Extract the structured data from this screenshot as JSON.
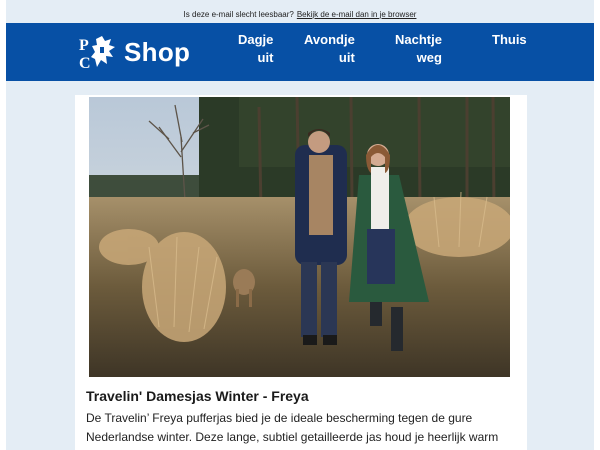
{
  "topbar": {
    "text": "Is deze e-mail slecht leesbaar?",
    "link": "Bekijk de e-mail dan in je browser"
  },
  "header": {
    "brand": "Shop",
    "brand_color": "#0750a5",
    "nav": [
      {
        "line1": "Dagje",
        "line2": "uit"
      },
      {
        "line1": "Avondje",
        "line2": "uit"
      },
      {
        "line1": "Nachtje",
        "line2": "weg"
      },
      {
        "line1": "Thuis",
        "line2": ""
      }
    ]
  },
  "product": {
    "image_icon": "product-photo",
    "title": "Travelin' Damesjas Winter - Freya",
    "description": "De Travelin’ Freya pufferjas bied je de ideale bescherming tegen de gure Nederlandse winter. Deze lange, subtiel getailleerde jas houd je heerlijk warm"
  }
}
